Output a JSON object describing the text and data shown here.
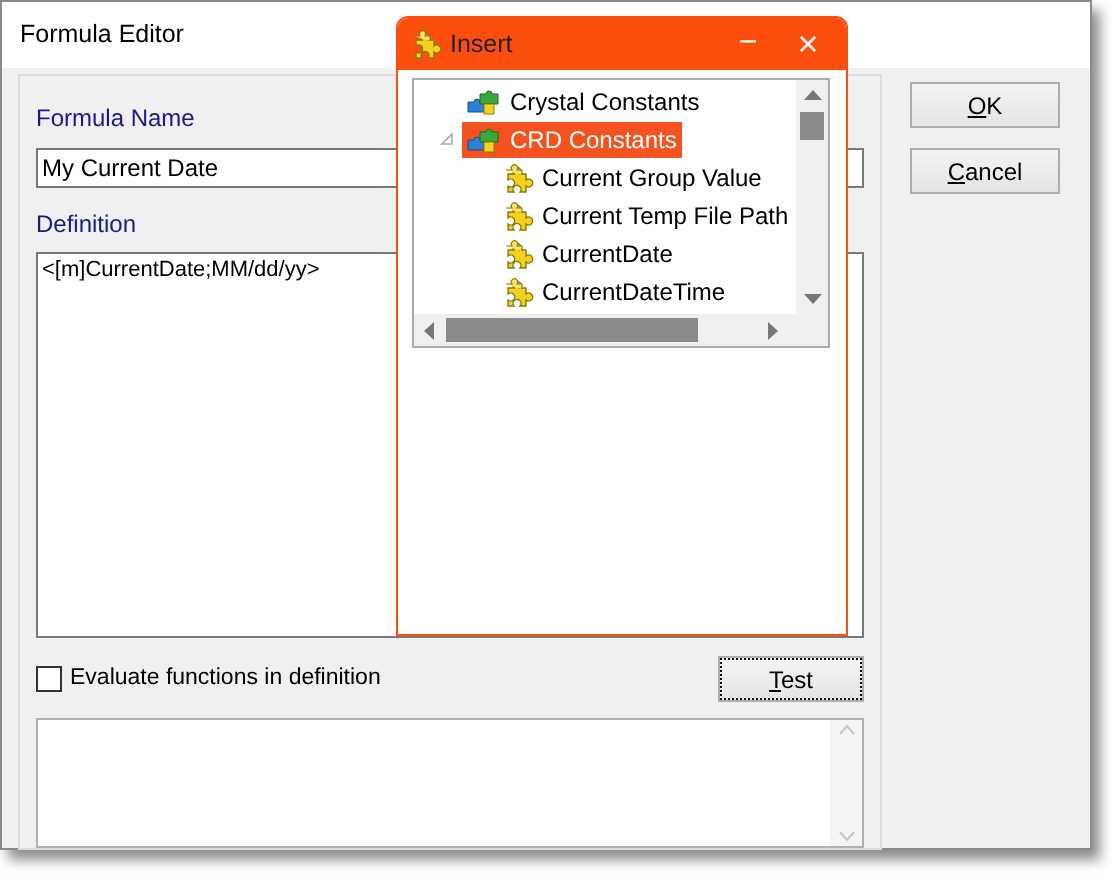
{
  "window": {
    "title": "Formula Editor"
  },
  "formula_name": {
    "label": "Formula Name",
    "value": "My Current Date"
  },
  "definition": {
    "label": "Definition",
    "value": "<[m]CurrentDate;MM/dd/yy>"
  },
  "evaluate_checkbox": {
    "label": "Evaluate functions in definition",
    "checked": false
  },
  "test_button": {
    "label": "Test",
    "mnemonic": true
  },
  "buttons": [
    {
      "label": "OK",
      "mnemonic": true
    },
    {
      "label": "Cancel",
      "mnemonic": true
    }
  ],
  "insert_popup": {
    "title": "Insert",
    "minimize": "−",
    "close": "×",
    "tree": [
      {
        "label": "Crystal Constants",
        "kind": "group",
        "selected": false,
        "expanded": false
      },
      {
        "label": "CRD Constants",
        "kind": "group",
        "selected": true,
        "expanded": true,
        "children": [
          {
            "label": "Current Group Value",
            "kind": "item",
            "selected": false
          },
          {
            "label": "Current Temp File Path",
            "kind": "item",
            "selected": false
          },
          {
            "label": "CurrentDate",
            "kind": "item",
            "selected": false
          },
          {
            "label": "CurrentDateTime",
            "kind": "item",
            "selected": false
          }
        ]
      }
    ]
  }
}
